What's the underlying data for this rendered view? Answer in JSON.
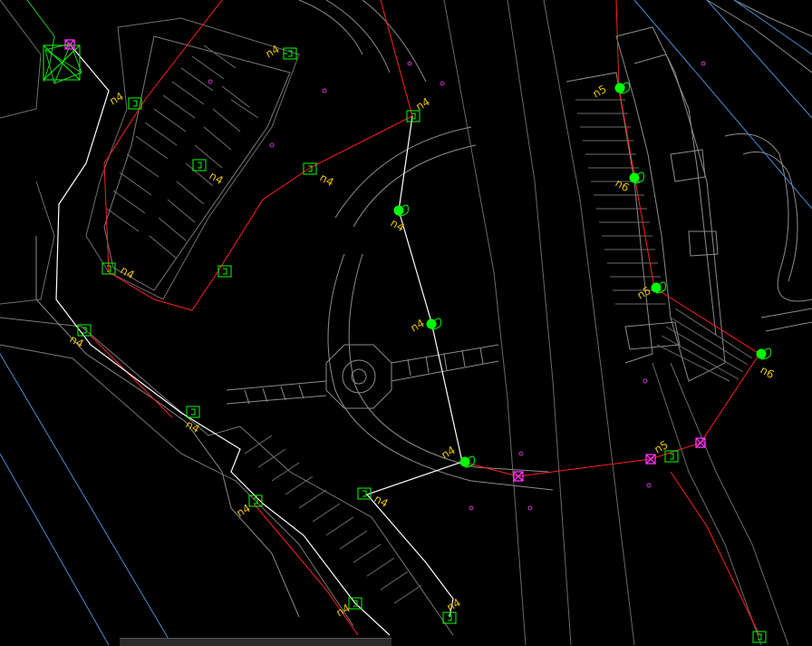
{
  "labels": [
    "n4",
    "n4",
    "n4",
    "n4",
    "n4",
    "n4",
    "n4",
    "n4",
    "n4",
    "n4",
    "n4",
    "n4",
    "n4",
    "n4",
    "n4",
    "n5",
    "n6",
    "n5",
    "n6",
    "n5",
    "n4",
    "n4"
  ],
  "colors": {
    "background": "#000000",
    "linework": "#9a9a9a",
    "red_line": "#ff2020",
    "white_line": "#ffffff",
    "green_symbol": "#00ff00",
    "magenta_symbol": "#ff33ff",
    "label": "#e8c000",
    "blue_line": "#4a8fd4"
  }
}
